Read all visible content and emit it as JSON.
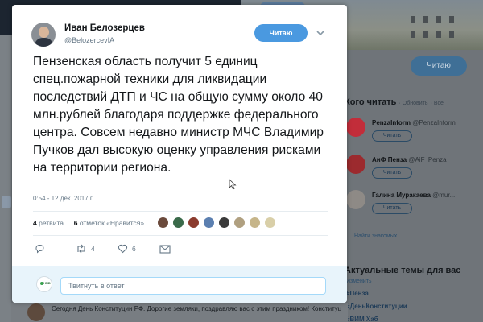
{
  "background": {
    "cover_button_label": "Читаю",
    "follow_top_label": "Читаю",
    "who_to_follow": {
      "title": "Кого читать",
      "refresh": "Обновить",
      "all": "Все",
      "users": [
        {
          "name": "PenzaInform",
          "handle": "@PenzaInform",
          "follow_label": "Читать",
          "avatar_color": "#c22d3a"
        },
        {
          "name": "АиФ Пенза",
          "handle": "@AiF_Penza",
          "follow_label": "Читать",
          "avatar_color": "#9c2a2e"
        },
        {
          "name": "Галина Муракаева",
          "handle": "@mur...",
          "follow_label": "Читать",
          "avatar_color": "#8e8a86"
        }
      ],
      "more": "Найти знакомых"
    },
    "trends": {
      "title": "Актуальные темы для вас",
      "change": "Изменить",
      "items": [
        "#Пенза",
        "#ДеньКонституции",
        "#ВИМ Хаб"
      ]
    },
    "bottom_tweet": "Сегодня День Конституции РФ. Дорогие земляки, поздравляю вас с этим праздником! Конституция - главный Закон страны,символизирующий"
  },
  "tweet": {
    "author_name": "Иван Белозерцев",
    "author_handle": "@BelozercevIA",
    "follow_button_label": "Читаю",
    "text": "Пензенская область получит 5 единиц спец.пожарной техники для ликвидации последствий ДТП и ЧС на общую сумму около 40 млн.рублей благодаря поддержке федерального центра. Совсем недавно министр МЧС Владимир Пучков дал высокую оценку управления рисками на территории региона.",
    "timestamp": "0:54 - 12 дек. 2017 г.",
    "retweets_count": "4",
    "retweets_label": "ретвита",
    "likes_count": "6",
    "likes_label": "отметок «Нравится»",
    "liker_colors": [
      "#6b4a3c",
      "#3a6a4a",
      "#8b3b2e",
      "#5b7fb0",
      "#3a3a3a",
      "#b0a080",
      "#c6b58a",
      "#d9cfa8"
    ],
    "actions": {
      "reply_count": "",
      "retweet_count": "4",
      "like_count": "6"
    },
    "reply_placeholder": "Твитнуть в ответ",
    "reply_avatar_text": "HNB"
  },
  "colors": {
    "accent": "#4a99e0",
    "text": "#14171a",
    "muted": "#657786",
    "reply_bg": "#e8f4fb"
  }
}
